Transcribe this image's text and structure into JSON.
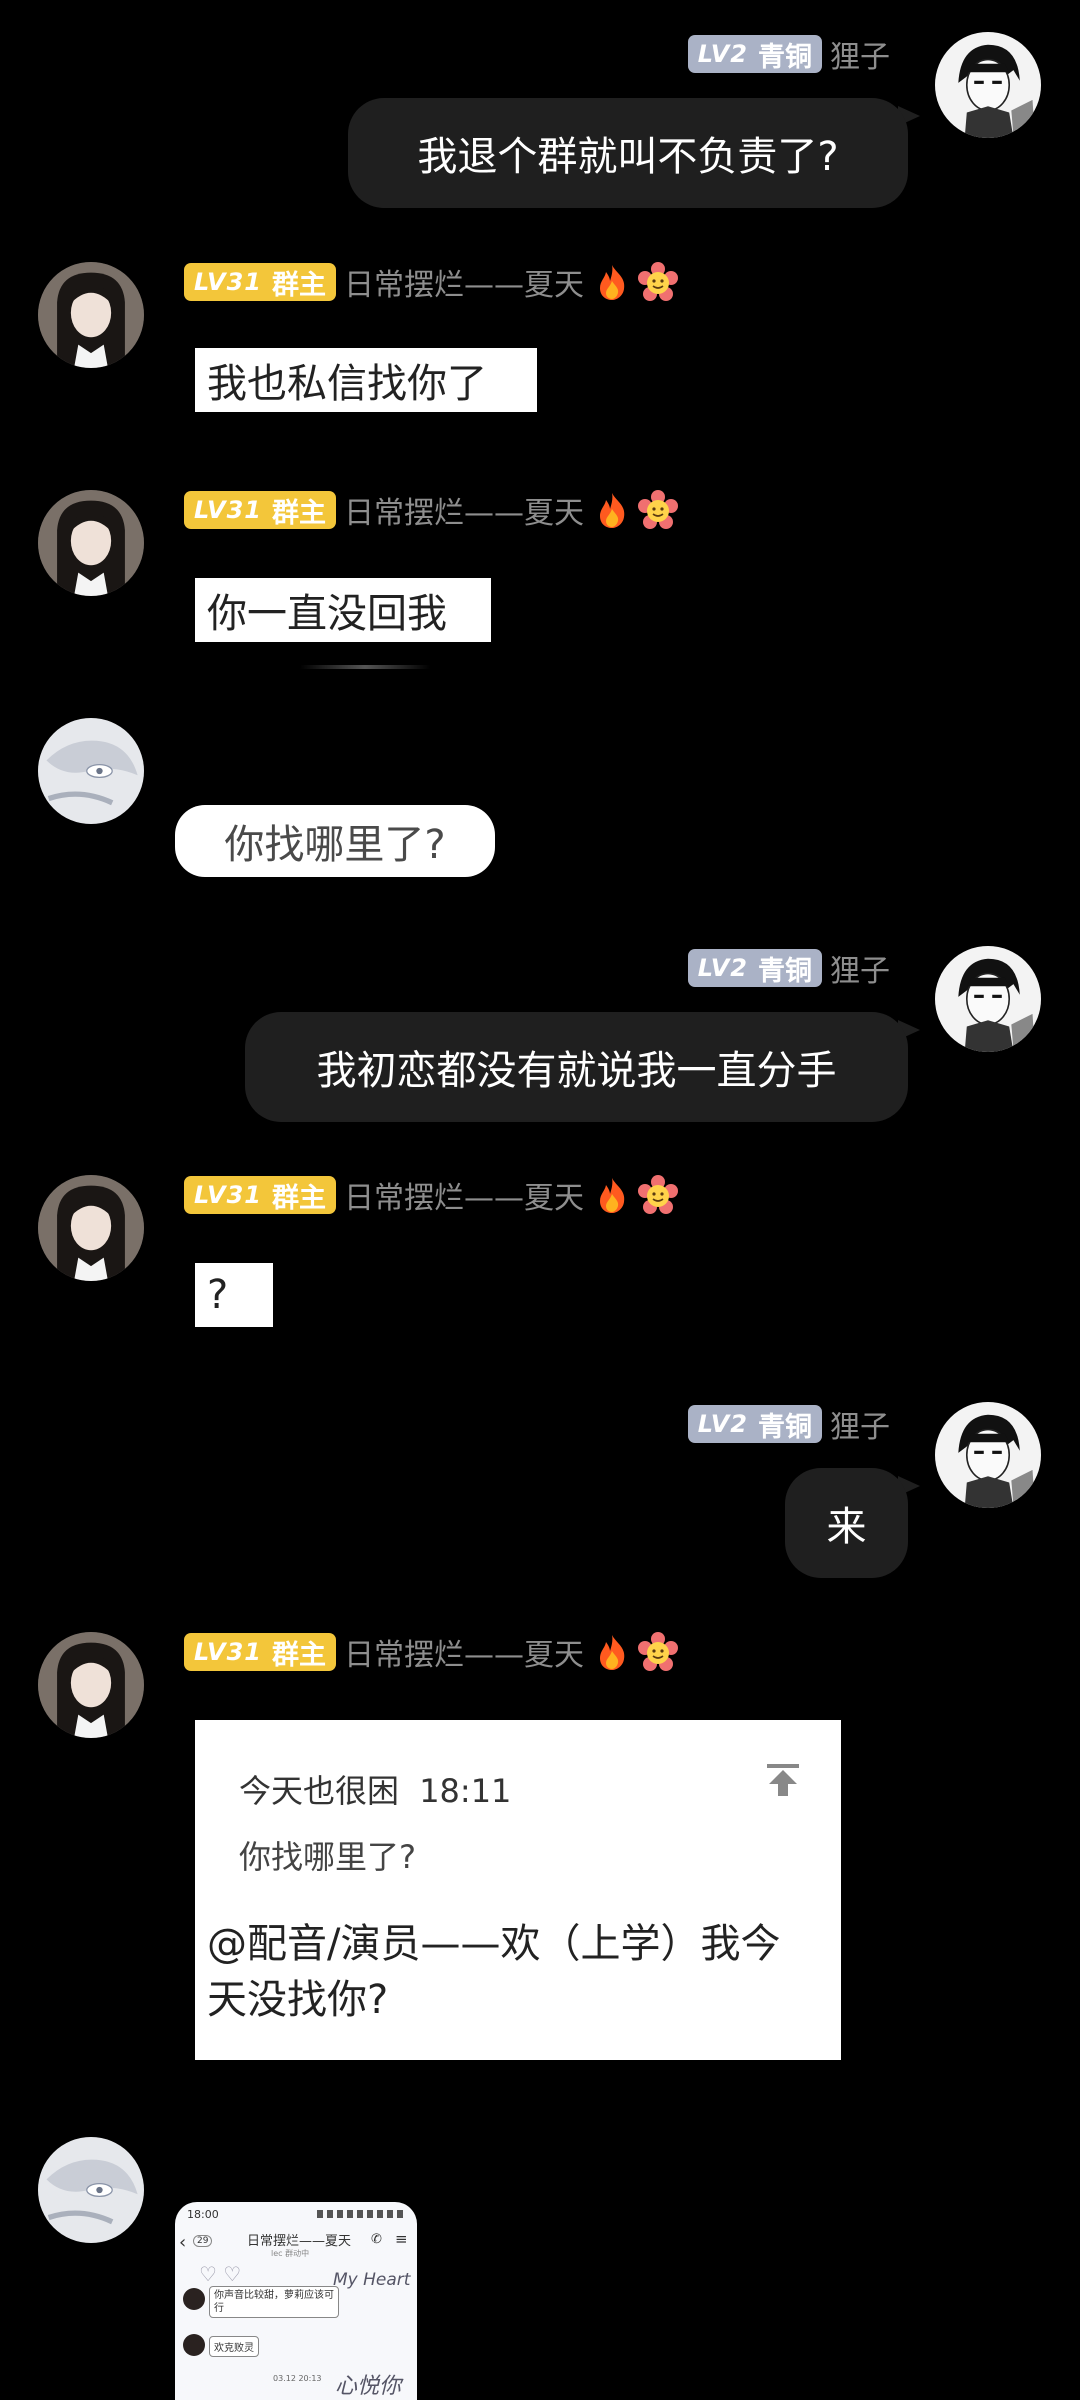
{
  "users": {
    "self": {
      "level": "LV2",
      "role": "青铜",
      "name": "狸子"
    },
    "owner": {
      "level": "LV31",
      "role": "群主",
      "name": "日常摆烂——夏天"
    }
  },
  "messages": [
    {
      "id": "m1",
      "text": "我退个群就叫不负责了?"
    },
    {
      "id": "m2",
      "text": "我也私信找你了"
    },
    {
      "id": "m3",
      "text": "你一直没回我"
    },
    {
      "id": "m4",
      "text": "你找哪里了?"
    },
    {
      "id": "m5",
      "text": "我初恋都没有就说我一直分手"
    },
    {
      "id": "m6",
      "text": "?"
    },
    {
      "id": "m7",
      "text": "来"
    }
  ],
  "reply": {
    "quoted_author": "今天也很困",
    "quoted_time": "18:11",
    "quoted_text": "你找哪里了?",
    "body": "@配音/演员——欢（上学）我今天没找你?"
  },
  "screenshot_thumb": {
    "time": "18:00",
    "back_count": "29",
    "chat_title": "日常摆烂——夏天",
    "chat_subtitle": "lec 群动中",
    "line1": "你声音比较甜，萝莉应该可行",
    "line2": "欢克败灵",
    "date": "03.12 20:13",
    "deco1": "My Heart",
    "deco2": "心悦你"
  },
  "icons": [
    "fire-emoji-icon",
    "flower-emoji-icon",
    "pin-to-top-icon"
  ],
  "colors": {
    "background": "#000000",
    "dark_bubble": "#1f1f1f",
    "lv2_badge": "#aab2c6",
    "lv31_badge": "#f3c63a",
    "nickname": "#8e8e8e"
  }
}
